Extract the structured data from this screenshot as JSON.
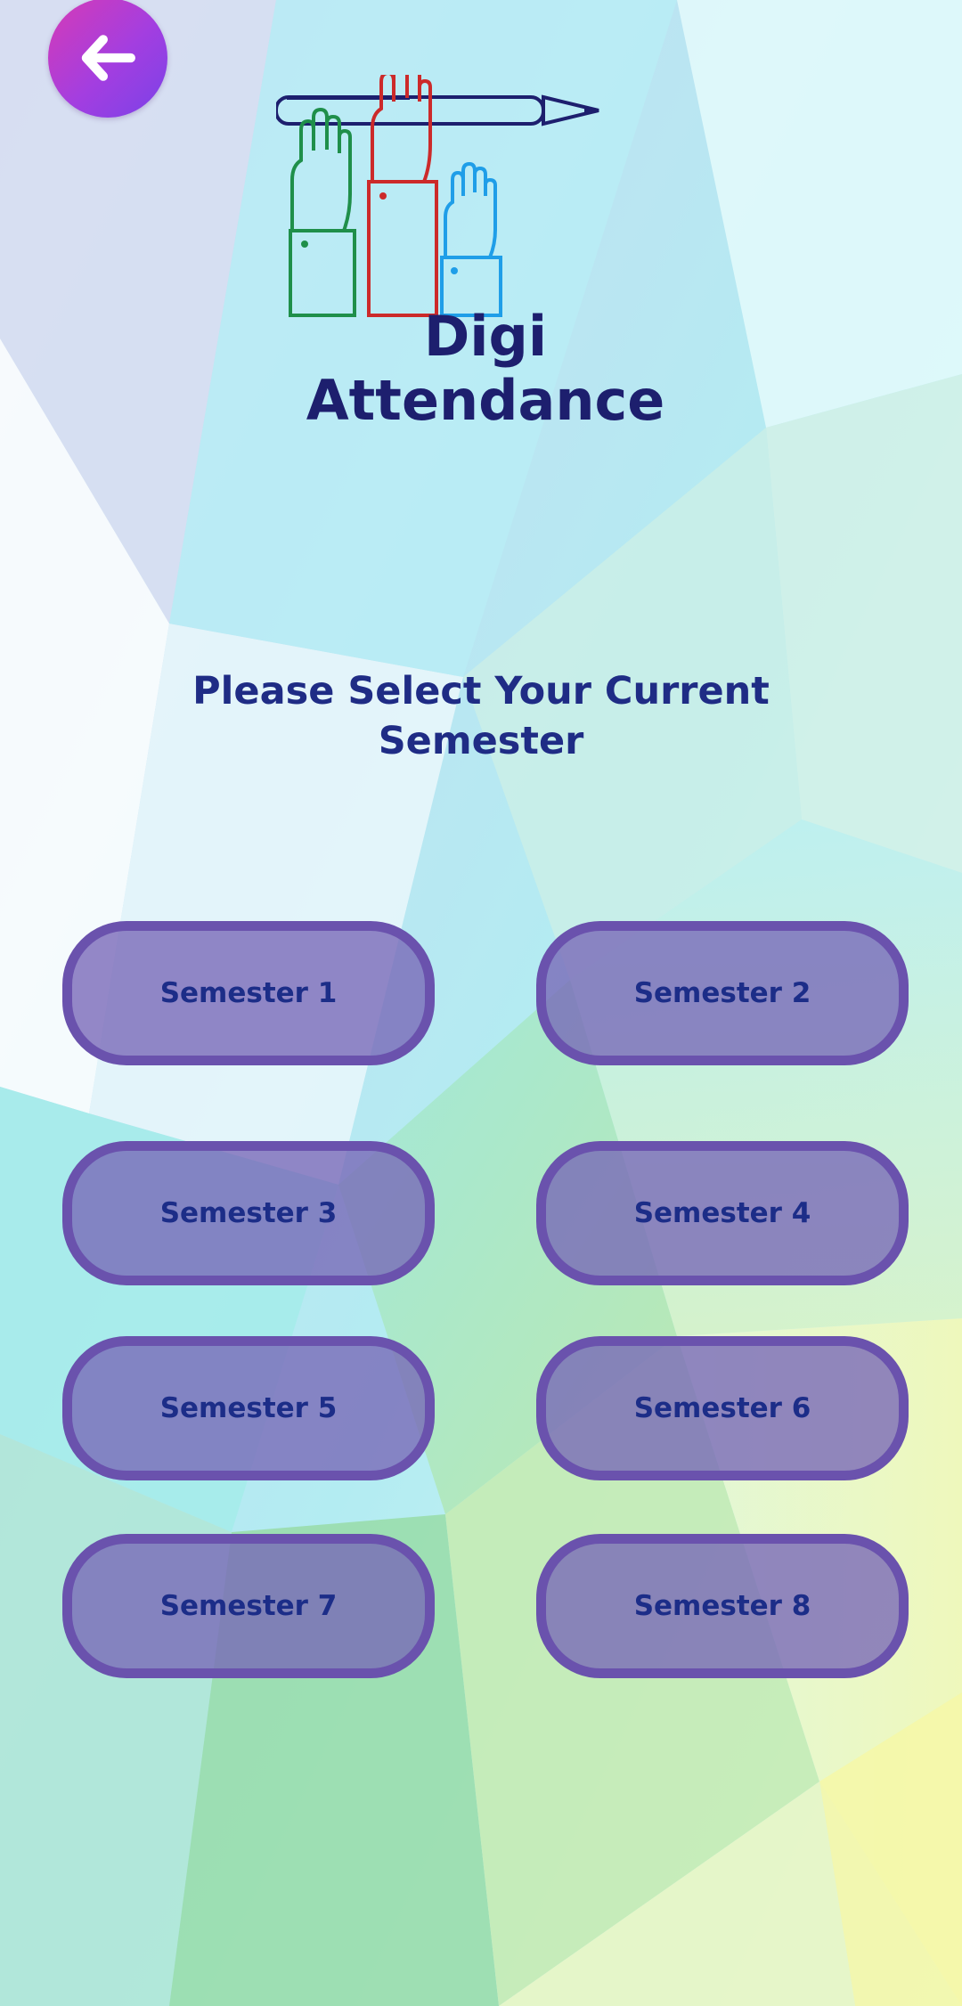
{
  "header": {
    "back_icon": "arrow-left-icon",
    "app_name": "Digi Attendance"
  },
  "main": {
    "title": "Please Select Your Current Semester",
    "semesters": [
      {
        "label": "Semester 1"
      },
      {
        "label": "Semester 2"
      },
      {
        "label": "Semester 3"
      },
      {
        "label": "Semester 4"
      },
      {
        "label": "Semester 5"
      },
      {
        "label": "Semester 6"
      },
      {
        "label": "Semester 7"
      },
      {
        "label": "Semester 8"
      }
    ]
  },
  "colors": {
    "button_fill": "#7766b7",
    "button_border": "#6a52ad",
    "text_primary": "#1c2d88",
    "back_gradient_start": "#d63bb6",
    "back_gradient_end": "#7a42e8",
    "logo_green": "#1f8f4a",
    "logo_red": "#cc2a2a",
    "logo_blue": "#1f9ee8"
  }
}
